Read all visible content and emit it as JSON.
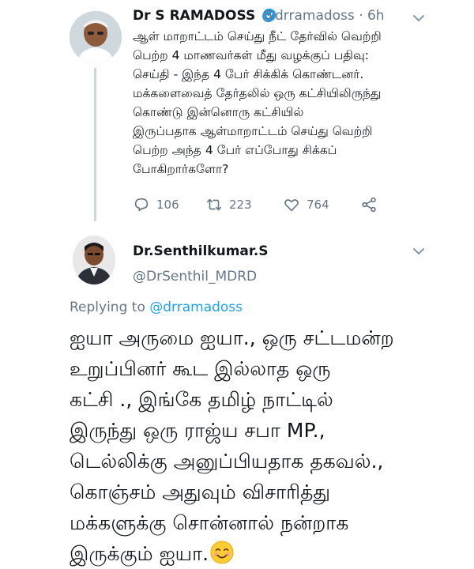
{
  "original_tweet": {
    "author_name": "Dr S RAMADOSS",
    "handle": "@drramadoss",
    "time": "· 6h",
    "lines": [
      "ஆள் மாறாட்டம் செய்து நீட் தேர்வில் வெற்றி",
      "பெற்ற 4 மாணவர்கள் மீது வழக்குப் பதிவு:",
      "செய்தி -  இந்த 4 பேர் சிக்கிக் கொண்டனர்.",
      "மக்களைவைத் தேர்தலில் ஒரு கட்சியிலிருந்து",
      "கொண்டு இன்னொரு கட்சியில்",
      "இருப்பதாக ஆள்மாறாட்டம் செய்து வெற்றி",
      "பெற்ற அந்த 4 பேர் எப்போது சிக்கப்",
      "போகிறார்களோ?"
    ],
    "reply_count": "106",
    "retweet_count": "223",
    "like_count": "764"
  },
  "reply_tweet": {
    "author_name": "Dr.Senthilkumar.S",
    "handle": "@DrSenthil_MDRD",
    "replying_prefix": "Replying to",
    "replying_handle": "@drramadoss",
    "lines": [
      "ஐயா அருமை ஐயா., ஒரு சட்டமன்ற",
      "உறுப்பினர் கூட இல்லாத ஒரு",
      "கட்சி ., இங்கே தமிழ் நாட்டில்",
      "இருந்து ஒரு ராஜ்ய சபா MP.,",
      "டெல்லிக்கு அனுப்பியதாக தகவல்.,",
      "கொஞ்சம் அதுவும் விசாரித்து",
      "மக்களுக்கு சொன்னால் நன்றாக",
      "இருக்கும் ஐயா."
    ],
    "emoji": "smiling-face-emoji"
  },
  "colors": {
    "verified_blue": "#1da1f2",
    "muted_gray": "#657786",
    "text": "#14171a"
  }
}
